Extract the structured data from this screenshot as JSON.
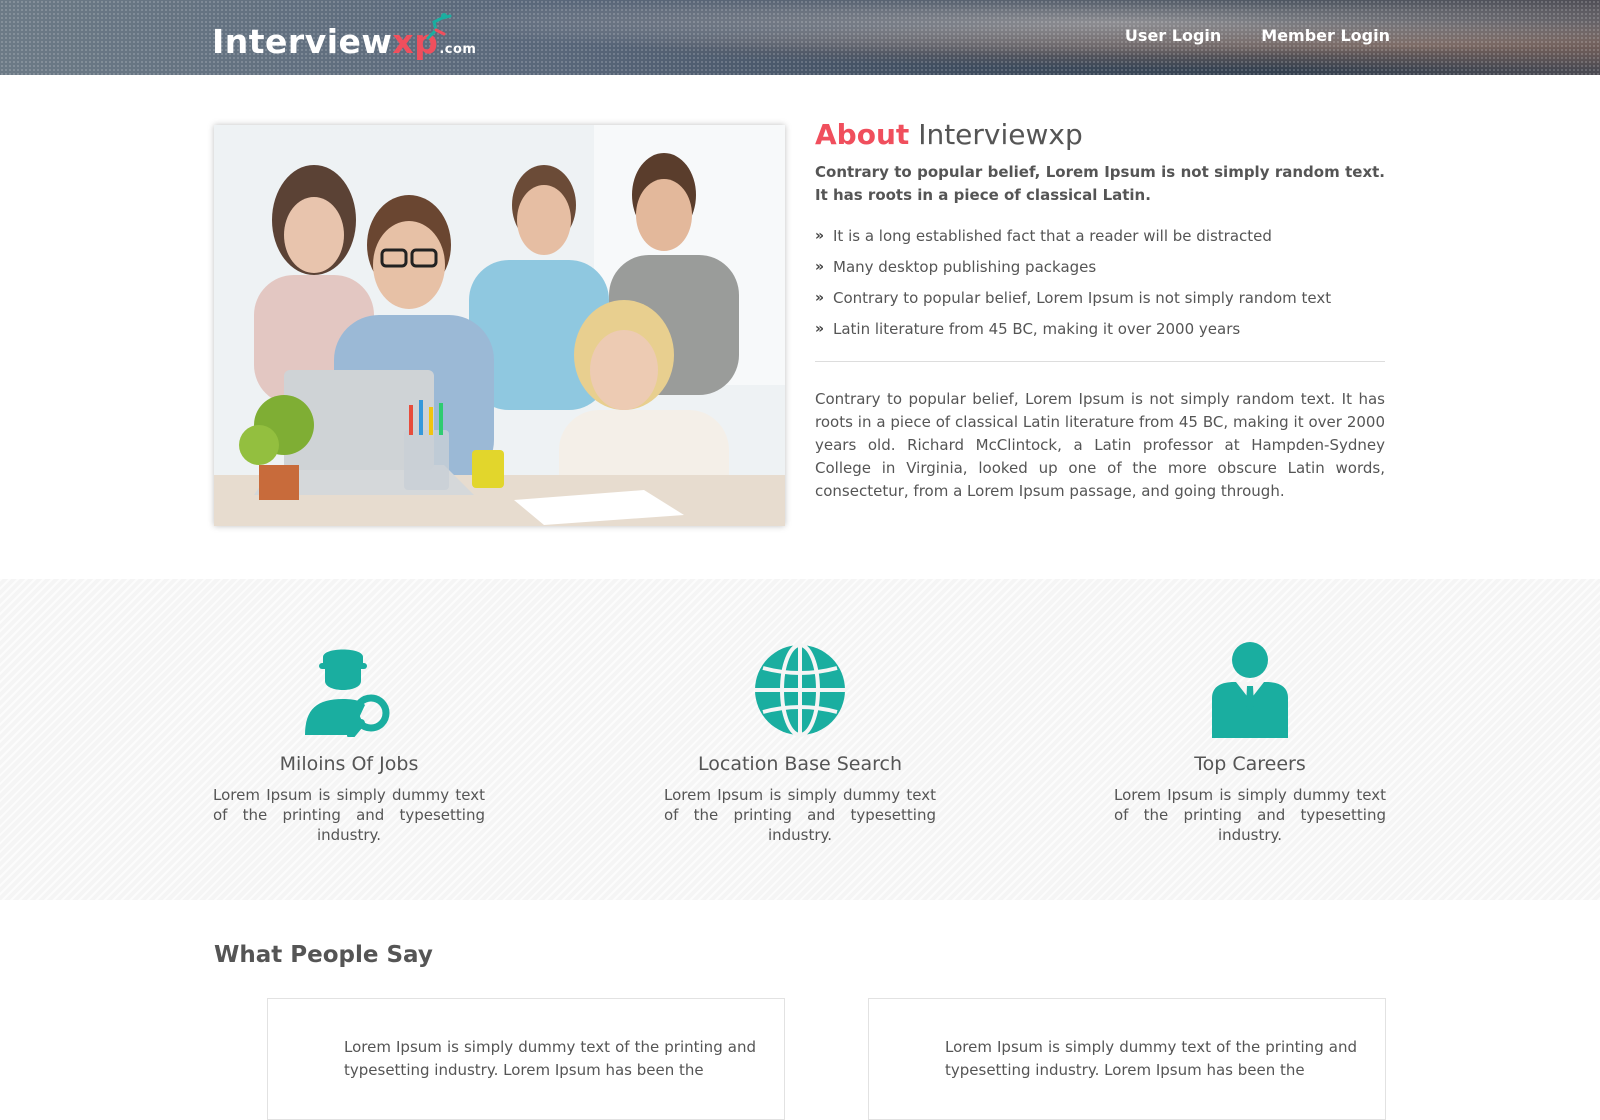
{
  "header": {
    "logo": {
      "main": "Interview",
      "accent": "xp",
      "suffix": ".com"
    },
    "nav": [
      {
        "label": "User Login"
      },
      {
        "label": "Member Login"
      }
    ]
  },
  "about": {
    "heading_accent": "About",
    "heading_rest": "Interviewxp",
    "lead": "Contrary to popular belief, Lorem Ipsum is not simply random text. It has roots in a piece of classical Latin.",
    "bullets": [
      "It is a long established fact that a reader will be distracted",
      "Many desktop publishing packages",
      "Contrary to popular belief, Lorem Ipsum is not simply random text",
      "Latin literature from 45 BC, making it over 2000 years"
    ],
    "body": "Contrary to popular belief, Lorem Ipsum is not simply random text. It has roots in a piece of classical Latin literature from 45 BC, making it over 2000 years old. Richard McClintock, a Latin professor at Hampden-Sydney College in Virginia, looked up one of the more obscure Latin words, consectetur, from a Lorem Ipsum passage, and going through."
  },
  "features": [
    {
      "icon": "job-search-icon",
      "title": "Miloins Of Jobs",
      "text": "Lorem Ipsum is simply dummy text of the printing and typesetting industry."
    },
    {
      "icon": "globe-icon",
      "title": "Location Base Search",
      "text": "Lorem Ipsum is simply dummy text of the printing and typesetting industry."
    },
    {
      "icon": "businessman-icon",
      "title": "Top Careers",
      "text": "Lorem Ipsum is simply dummy text of the printing and typesetting industry."
    }
  ],
  "testimonials": {
    "title": "What People Say",
    "items": [
      {
        "text": "Lorem Ipsum is simply dummy text of the printing and typesetting industry. Lorem Ipsum has been the"
      },
      {
        "text": "Lorem Ipsum is simply dummy text of the printing and typesetting industry. Lorem Ipsum has been the"
      }
    ]
  },
  "colors": {
    "accent_red": "#f04f5d",
    "teal": "#1aaea0",
    "text": "#555555"
  }
}
